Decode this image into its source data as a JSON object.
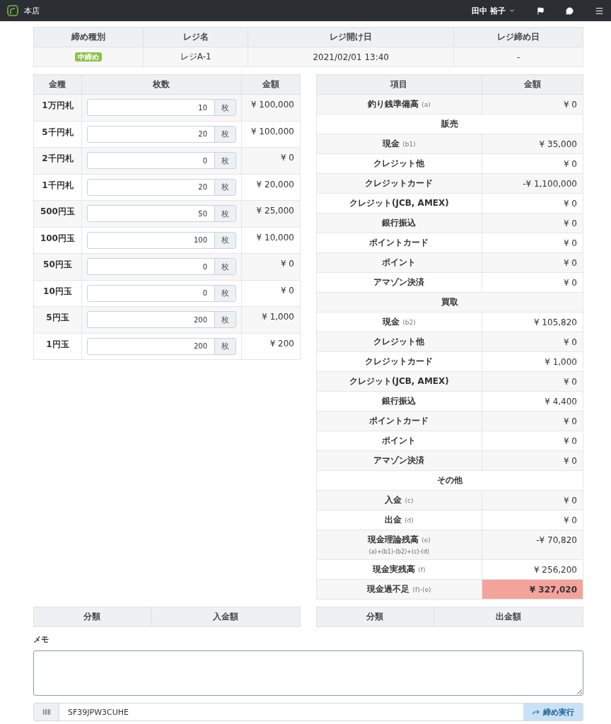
{
  "header": {
    "store": "本店",
    "user": "田中 裕子"
  },
  "summary": {
    "columns": [
      "締め種別",
      "レジ名",
      "レジ開け日",
      "レジ締め日"
    ],
    "row": {
      "type": "中締め",
      "register": "レジA-1",
      "opened": "2021/02/01 13:40",
      "closed": "-"
    }
  },
  "cash": {
    "columns": [
      "金種",
      "枚数",
      "金額"
    ],
    "rows": [
      {
        "label": "1万円札",
        "count": "10",
        "unit": "枚",
        "amount": "¥ 100,000"
      },
      {
        "label": "5千円札",
        "count": "20",
        "unit": "枚",
        "amount": "¥ 100,000"
      },
      {
        "label": "2千円札",
        "count": "0",
        "unit": "枚",
        "amount": "¥ 0"
      },
      {
        "label": "1千円札",
        "count": "20",
        "unit": "枚",
        "amount": "¥ 20,000"
      },
      {
        "label": "500円玉",
        "count": "50",
        "unit": "枚",
        "amount": "¥ 25,000"
      },
      {
        "label": "100円玉",
        "count": "100",
        "unit": "枚",
        "amount": "¥ 10,000"
      },
      {
        "label": "50円玉",
        "count": "0",
        "unit": "枚",
        "amount": "¥ 0"
      },
      {
        "label": "10円玉",
        "count": "0",
        "unit": "枚",
        "amount": "¥ 0"
      },
      {
        "label": "5円玉",
        "count": "200",
        "unit": "枚",
        "amount": "¥ 1,000"
      },
      {
        "label": "1円玉",
        "count": "200",
        "unit": "枚",
        "amount": "¥ 200"
      }
    ]
  },
  "totals": {
    "columns": [
      "項目",
      "金額"
    ],
    "rows": [
      {
        "kind": "item",
        "label": "釣り銭準備高",
        "note": "(a)",
        "value": "¥ 0",
        "alert": false
      },
      {
        "kind": "section",
        "label": "販売"
      },
      {
        "kind": "item",
        "label": "現金",
        "note": "(b1)",
        "value": "¥ 35,000",
        "alert": false
      },
      {
        "kind": "item",
        "label": "クレジット他",
        "value": "¥ 0",
        "alert": false
      },
      {
        "kind": "item",
        "label": "クレジットカード",
        "value": "-¥ 1,100,000",
        "alert": false
      },
      {
        "kind": "item",
        "label": "クレジット(JCB, AMEX)",
        "value": "¥ 0",
        "alert": false
      },
      {
        "kind": "item",
        "label": "銀行振込",
        "value": "¥ 0",
        "alert": false
      },
      {
        "kind": "item",
        "label": "ポイントカード",
        "value": "¥ 0",
        "alert": false
      },
      {
        "kind": "item",
        "label": "ポイント",
        "value": "¥ 0",
        "alert": false
      },
      {
        "kind": "item",
        "label": "アマゾン決済",
        "value": "¥ 0",
        "alert": false
      },
      {
        "kind": "section",
        "label": "買取"
      },
      {
        "kind": "item",
        "label": "現金",
        "note": "(b2)",
        "value": "¥ 105,820",
        "alert": false
      },
      {
        "kind": "item",
        "label": "クレジット他",
        "value": "¥ 0",
        "alert": false
      },
      {
        "kind": "item",
        "label": "クレジットカード",
        "value": "¥ 1,000",
        "alert": false
      },
      {
        "kind": "item",
        "label": "クレジット(JCB, AMEX)",
        "value": "¥ 0",
        "alert": false
      },
      {
        "kind": "item",
        "label": "銀行振込",
        "value": "¥ 4,400",
        "alert": false
      },
      {
        "kind": "item",
        "label": "ポイントカード",
        "value": "¥ 0",
        "alert": false
      },
      {
        "kind": "item",
        "label": "ポイント",
        "value": "¥ 0",
        "alert": false
      },
      {
        "kind": "item",
        "label": "アマゾン決済",
        "value": "¥ 0",
        "alert": false
      },
      {
        "kind": "section",
        "label": "その他"
      },
      {
        "kind": "item",
        "label": "入金",
        "note": "(c)",
        "value": "¥ 0",
        "alert": false
      },
      {
        "kind": "item",
        "label": "出金",
        "note": "(d)",
        "value": "¥ 0",
        "alert": false
      },
      {
        "kind": "item",
        "label": "現金理論残高",
        "note": "(e)",
        "formula": "(a)+(b1)-(b2)+(c)-(d)",
        "value": "-¥ 70,820",
        "alert": false
      },
      {
        "kind": "item",
        "label": "現金実残高",
        "note": "(f)",
        "value": "¥ 256,200",
        "alert": false
      },
      {
        "kind": "item",
        "label": "現金過不足",
        "note": "(f)-(e)",
        "value": "¥ 327,020",
        "alert": true
      }
    ]
  },
  "deposits": {
    "columns": [
      "分類",
      "入金額"
    ]
  },
  "withdrawals": {
    "columns": [
      "分類",
      "出金額"
    ]
  },
  "memo": {
    "label": "メモ"
  },
  "barcode": {
    "value": "SF39JPW3CUHE",
    "button": "締め実行"
  }
}
